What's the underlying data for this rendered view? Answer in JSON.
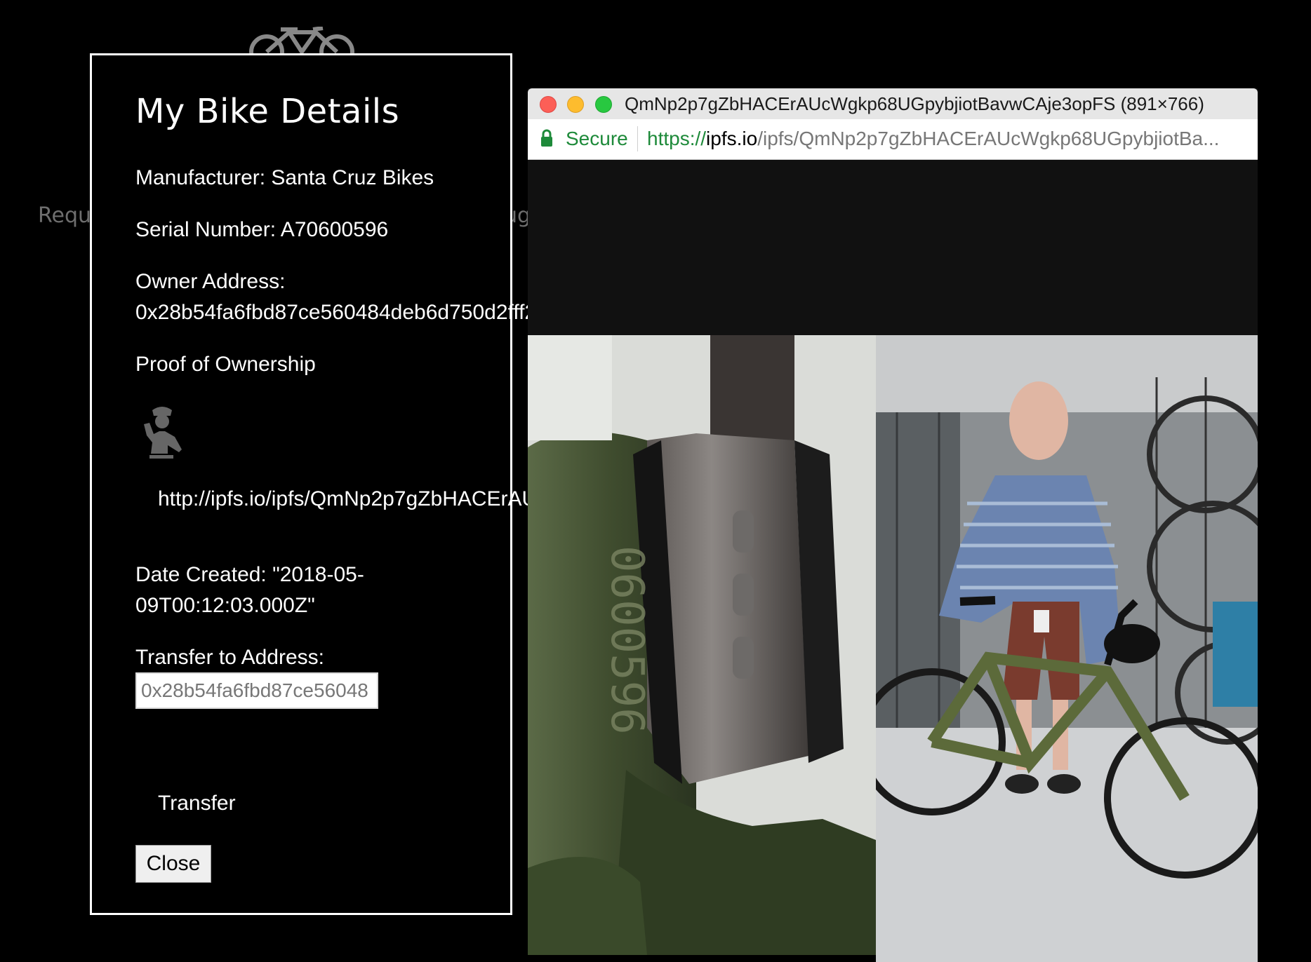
{
  "background_page": {
    "left_text": "Requ",
    "right_text": "ug"
  },
  "modal": {
    "title": "My Bike Details",
    "manufacturer": "Manufacturer: Santa Cruz Bikes",
    "serial_number": "Serial Number: A70600596",
    "owner_label": "Owner Address:",
    "owner_value": "0x28b54fa6fbd87ce560484deb6d750d2fff2",
    "proof_label": "Proof of Ownership",
    "proof_link": "http://ipfs.io/ipfs/QmNp2p7gZbHACErAU",
    "date_line1": "Date Created: \"2018-05-",
    "date_line2": "09T00:12:03.000Z\"",
    "transfer_label": "Transfer to Address:",
    "transfer_input_value": "0x28b54fa6fbd87ce56048",
    "transfer_button": "Transfer",
    "close_button": "Close"
  },
  "browser": {
    "window_title": "QmNp2p7gZbHACErAUcWgkp68UGpybjiotBavwCAje3opFS (891×766)",
    "secure_label": "Secure",
    "url_scheme": "https://",
    "url_host": "ipfs.io",
    "url_path": "/ipfs/QmNp2p7gZbHACErAUcWgkp68UGpybjiotBa..."
  },
  "colors": {
    "secure_green": "#1e8a3a",
    "close_light": "#fc5f57",
    "minimize_light": "#fdbc2e",
    "maximize_light": "#28c840"
  },
  "icons": [
    "bicycle-icon",
    "police-officer-icon",
    "lock-icon"
  ]
}
